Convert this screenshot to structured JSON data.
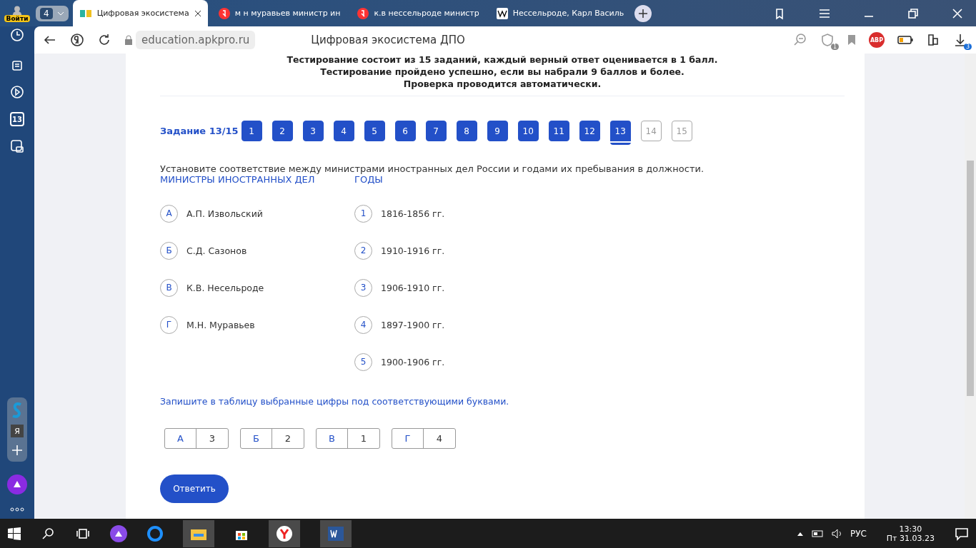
{
  "profile": {
    "label": "Войти"
  },
  "tab_count": "4",
  "tabs": [
    {
      "title": "Цифровая экосистема",
      "selected": true,
      "kind": "book"
    },
    {
      "title": "м н муравьев министр ин",
      "selected": false,
      "kind": "yandex"
    },
    {
      "title": "к.в нессельроде министр",
      "selected": false,
      "kind": "yandex"
    },
    {
      "title": "Нессельроде, Карл Василь",
      "selected": false,
      "kind": "wiki"
    }
  ],
  "address": {
    "url": "education.apkpro.ru",
    "page_title": "Цифровая экосистема ДПО"
  },
  "toolbar": {
    "adblock": "ABP",
    "shield_count": "1",
    "downloads_count": "3"
  },
  "sidebar": {
    "calendar": "13",
    "ya": "Я"
  },
  "intro": [
    "Тестирование состоит из 15 заданий, каждый верный ответ оценивается в 1 балл.",
    "Тестирование пройдено успешно, если вы набрали 9 баллов и более.",
    "Проверка проводится автоматически."
  ],
  "task_label": "Задание 13/15",
  "pages": [
    {
      "label": "1",
      "answered": true,
      "selected": false
    },
    {
      "label": "2",
      "answered": true,
      "selected": false
    },
    {
      "label": "3",
      "answered": true,
      "selected": false
    },
    {
      "label": "4",
      "answered": true,
      "selected": false
    },
    {
      "label": "5",
      "answered": true,
      "selected": false
    },
    {
      "label": "6",
      "answered": true,
      "selected": false
    },
    {
      "label": "7",
      "answered": true,
      "selected": false
    },
    {
      "label": "8",
      "answered": true,
      "selected": false
    },
    {
      "label": "9",
      "answered": true,
      "selected": false
    },
    {
      "label": "10",
      "answered": true,
      "selected": false
    },
    {
      "label": "11",
      "answered": true,
      "selected": false
    },
    {
      "label": "12",
      "answered": true,
      "selected": false
    },
    {
      "label": "13",
      "answered": true,
      "selected": true
    },
    {
      "label": "14",
      "answered": false,
      "selected": false
    },
    {
      "label": "15",
      "answered": false,
      "selected": false
    }
  ],
  "question": "Установите соответствие между министрами иностранных дел России и годами их пребывания в должности.",
  "left": {
    "heading": "МИНИСТРЫ ИНОСТРАННЫХ ДЕЛ",
    "items": [
      {
        "key": "А",
        "text": "А.П. Извольский"
      },
      {
        "key": "Б",
        "text": "С.Д. Сазонов"
      },
      {
        "key": "В",
        "text": "К.В. Несельроде"
      },
      {
        "key": "Г",
        "text": "М.Н. Муравьев"
      }
    ]
  },
  "right": {
    "heading": "ГОДЫ",
    "items": [
      {
        "key": "1",
        "text": "1816-1856 гг."
      },
      {
        "key": "2",
        "text": "1910-1916 гг."
      },
      {
        "key": "3",
        "text": "1906-1910 гг."
      },
      {
        "key": "4",
        "text": "1897-1900 гг."
      },
      {
        "key": "5",
        "text": "1900-1906 гг."
      }
    ]
  },
  "instruction": "Запишите в таблицу выбранные цифры под соответствующими буквами.",
  "answers": [
    {
      "letter": "А",
      "value": "3"
    },
    {
      "letter": "Б",
      "value": "2"
    },
    {
      "letter": "В",
      "value": "1"
    },
    {
      "letter": "Г",
      "value": "4"
    }
  ],
  "submit": "Ответить",
  "taskbar": {
    "lang": "РУС",
    "time": "13:30",
    "date": "Пт 31.03.23"
  }
}
